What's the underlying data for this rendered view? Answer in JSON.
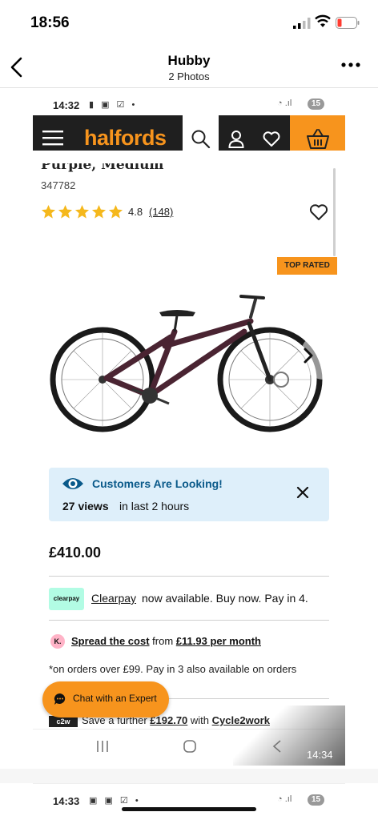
{
  "ios": {
    "time": "18:56"
  },
  "header": {
    "title": "Hubby",
    "subtitle": "2 Photos"
  },
  "android": {
    "time": "14:32",
    "badge": "15",
    "screenshot_time": "14:34"
  },
  "brand": {
    "logo": "halfords",
    "accent": "#f7941d",
    "dark": "#1f1f1f"
  },
  "product": {
    "name": "Purple, Medium",
    "code": "347782",
    "rating": "4.8",
    "rating_value": 4.8,
    "reviews": "(148)",
    "badge": "TOP RATED"
  },
  "alert": {
    "title": "Customers Are Looking!",
    "views_count": "27 views",
    "views_text": "in last 2 hours"
  },
  "price": "£410.00",
  "clearpay": {
    "logo": "clearpay",
    "link": "Clearpay",
    "text": "now available. Buy now. Pay in 4."
  },
  "klarna": {
    "logo": "K.",
    "link": "Spread the cost",
    "mid": "from",
    "amount": "£11.93 per month"
  },
  "note": "*on orders over £99. Pay in 3 also available on orders",
  "chat": {
    "label": "Chat with an Expert"
  },
  "cycle2work": {
    "logo": "c2w",
    "text_pre": "Save a further",
    "amount": "£192.70",
    "text_mid": "with",
    "link": "Cycle2work"
  },
  "photo2": {
    "time": "14:33",
    "badge": "15"
  },
  "icons": [
    "back-icon",
    "more-icon",
    "menu-icon",
    "search-icon",
    "user-icon",
    "heart-icon",
    "basket-icon",
    "star-icon",
    "chevron-right-icon",
    "eye-icon",
    "close-icon",
    "chat-icon",
    "recent-apps-icon",
    "home-icon",
    "android-back-icon"
  ]
}
